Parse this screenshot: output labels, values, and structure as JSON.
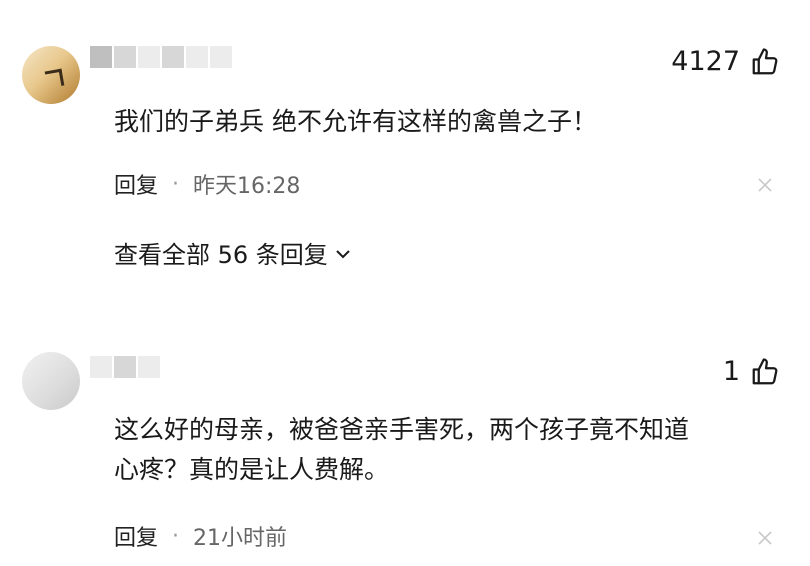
{
  "comments": [
    {
      "likes": "4127",
      "text": "我们的子弟兵 绝不允许有这样的禽兽之子！",
      "reply_label": "回复",
      "separator": "·",
      "time": "昨天16:28",
      "view_replies": "查看全部 56 条回复"
    },
    {
      "likes": "1",
      "text": "这么好的母亲，被爸爸亲手害死，两个孩子竟不知道\n心疼？真的是让人费解。",
      "reply_label": "回复",
      "separator": "·",
      "time": "21小时前"
    }
  ],
  "icons": {
    "like": "thumbs-up-icon",
    "close": "close-icon",
    "expand": "chevron-down-icon"
  },
  "colors": {
    "text": "#1a1a1a",
    "secondary": "#666666",
    "icon_light": "#c8c8c8"
  }
}
